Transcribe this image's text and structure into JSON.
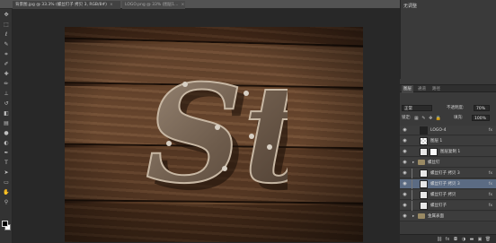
{
  "tabs": [
    {
      "label": "背景图.jpg @ 33.3% (螺丝钉子 拷贝 3, RGB/8#)",
      "close": "×"
    },
    {
      "label": "LOGO.png @ 33% (图层1...",
      "close": "×"
    }
  ],
  "toolbar": {
    "tools": [
      {
        "icon": "move-icon",
        "glyph": "✥"
      },
      {
        "icon": "marquee-icon",
        "glyph": "⬚"
      },
      {
        "icon": "lasso-icon",
        "glyph": "ℓ"
      },
      {
        "icon": "quick-select-icon",
        "glyph": "✎"
      },
      {
        "icon": "crop-icon",
        "glyph": "⌗"
      },
      {
        "icon": "eyedropper-icon",
        "glyph": "✐"
      },
      {
        "icon": "healing-icon",
        "glyph": "✚"
      },
      {
        "icon": "brush-icon",
        "glyph": "✏"
      },
      {
        "icon": "stamp-icon",
        "glyph": "⊥"
      },
      {
        "icon": "history-brush-icon",
        "glyph": "↺"
      },
      {
        "icon": "eraser-icon",
        "glyph": "◧"
      },
      {
        "icon": "gradient-icon",
        "glyph": "▤"
      },
      {
        "icon": "blur-icon",
        "glyph": "●"
      },
      {
        "icon": "dodge-icon",
        "glyph": "◐"
      },
      {
        "icon": "pen-icon",
        "glyph": "✒"
      },
      {
        "icon": "type-icon",
        "glyph": "T"
      },
      {
        "icon": "path-select-icon",
        "glyph": "➤"
      },
      {
        "icon": "shape-icon",
        "glyph": "▭"
      },
      {
        "icon": "hand-icon",
        "glyph": "✋"
      },
      {
        "icon": "zoom-icon",
        "glyph": "⚲"
      }
    ],
    "foreground_color": "#000000",
    "background_color": "#ffffff"
  },
  "artwork": {
    "text": "St",
    "letter_color": "#7d6a58",
    "shadow_color": "#1e120a"
  },
  "dock": {
    "top_panel_title": "无调整",
    "panel_tabs": [
      "图层",
      "通道",
      "路径"
    ],
    "blend_mode": "正常",
    "opacity_label": "不透明度:",
    "opacity_value": "70%",
    "lock_label": "锁定:",
    "lock_icons": "▦ ✎ ✥ 🔒",
    "fill_label": "填充:",
    "fill_value": "100%"
  },
  "layers": [
    {
      "name": "LOGO-4",
      "thumb": "dark",
      "kind": "layer",
      "fx": "fx",
      "indent": false,
      "selected": false
    },
    {
      "name": "图层 1",
      "thumb": "checker",
      "kind": "layer",
      "fx": "",
      "indent": false,
      "selected": false
    },
    {
      "name": "图层复制 1",
      "thumb": "white",
      "kind": "masked",
      "fx": "",
      "indent": false,
      "selected": false
    },
    {
      "name": "螺丝钉",
      "thumb": "",
      "kind": "group",
      "fx": "",
      "indent": false,
      "selected": false
    },
    {
      "name": "螺丝钉子 拷贝 3",
      "thumb": "white",
      "kind": "layer",
      "fx": "fx",
      "indent": true,
      "selected": false
    },
    {
      "name": "螺丝钉子 拷贝 3",
      "thumb": "white",
      "kind": "layer",
      "fx": "fx",
      "indent": true,
      "selected": true
    },
    {
      "name": "螺丝钉子 拷贝",
      "thumb": "white",
      "kind": "layer",
      "fx": "fx",
      "indent": true,
      "selected": false
    },
    {
      "name": "螺丝钉子",
      "thumb": "white",
      "kind": "layer",
      "fx": "fx",
      "indent": true,
      "selected": false
    },
    {
      "name": "金属表面",
      "thumb": "",
      "kind": "group",
      "fx": "",
      "indent": false,
      "selected": false
    }
  ],
  "layer_footer": [
    {
      "icon": "link-icon",
      "glyph": "⛓"
    },
    {
      "icon": "fx-icon",
      "glyph": "fx"
    },
    {
      "icon": "mask-icon",
      "glyph": "◘"
    },
    {
      "icon": "adjustment-icon",
      "glyph": "◑"
    },
    {
      "icon": "new-group-icon",
      "glyph": "▬"
    },
    {
      "icon": "new-layer-icon",
      "glyph": "▣"
    },
    {
      "icon": "trash-icon",
      "glyph": "🗑"
    }
  ]
}
